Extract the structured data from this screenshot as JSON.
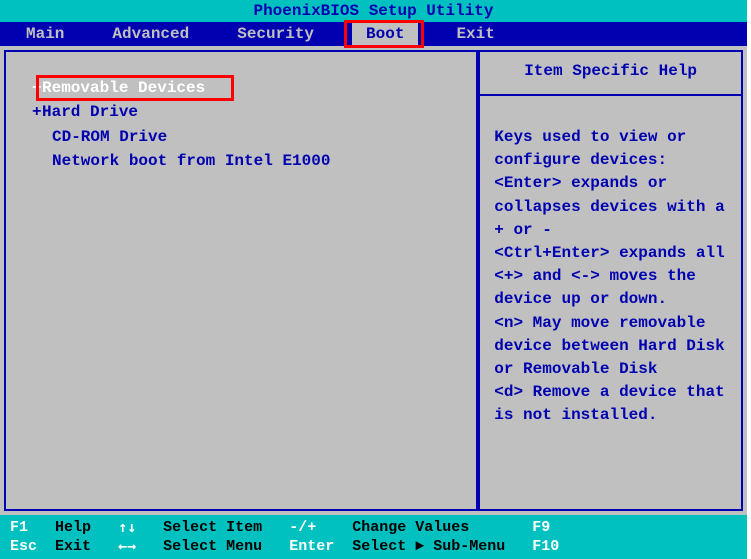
{
  "title": "PhoenixBIOS Setup Utility",
  "menu": {
    "items": [
      "Main",
      "Advanced",
      "Security",
      "Boot",
      "Exit"
    ],
    "active": "Boot"
  },
  "boot": {
    "items": [
      {
        "label": "Removable Devices",
        "expandable": true,
        "selected": true
      },
      {
        "label": "Hard Drive",
        "expandable": true,
        "selected": false
      },
      {
        "label": "CD-ROM Drive",
        "expandable": false,
        "selected": false
      },
      {
        "label": "Network boot from Intel E1000",
        "expandable": false,
        "selected": false
      }
    ]
  },
  "help": {
    "title": "Item Specific Help",
    "body": "Keys used to view or configure devices:\n<Enter> expands or collapses devices with a + or -\n<Ctrl+Enter> expands all\n<+> and <-> moves the device up or down.\n<n> May move removable device between Hard Disk or Removable Disk\n<d> Remove a device that is not installed."
  },
  "footer": {
    "row1": {
      "k1": "F1",
      "l1": "Help",
      "k2": "↑↓",
      "l2": "Select Item",
      "k3": "-/+",
      "l3": "Change Values",
      "k4": "F9"
    },
    "row2": {
      "k1": "Esc",
      "l1": "Exit",
      "k2": "←→",
      "l2": "Select Menu",
      "k3": "Enter",
      "l3": "Select ► Sub-Menu",
      "k4": "F10"
    }
  }
}
